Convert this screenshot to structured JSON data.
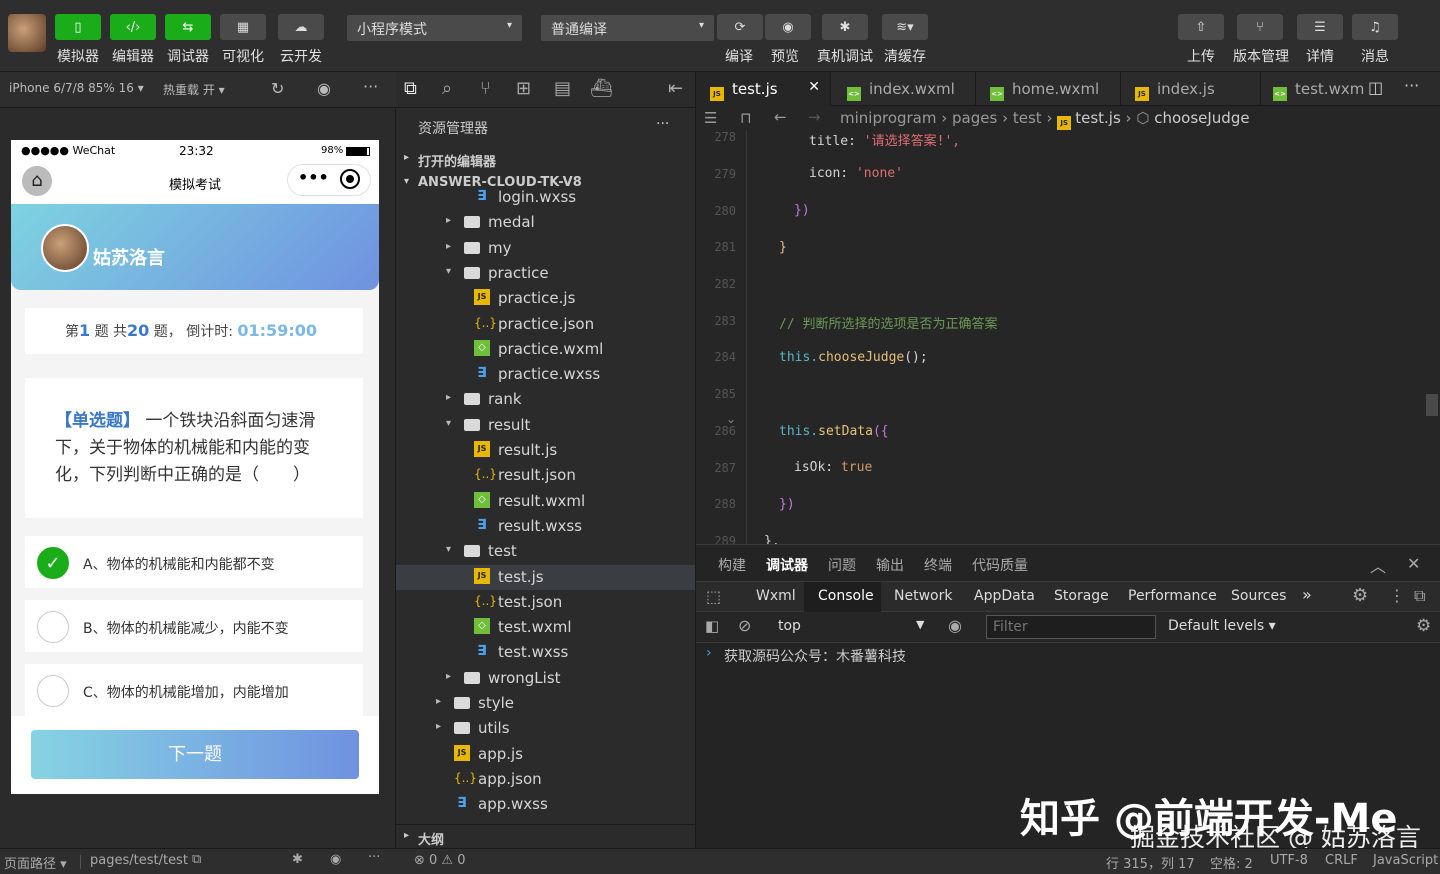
{
  "toolbar": {
    "buttons": [
      {
        "label": "模拟器",
        "icon": "phone-icon"
      },
      {
        "label": "编辑器",
        "icon": "code-icon"
      },
      {
        "label": "调试器",
        "icon": "debug-icon"
      },
      {
        "label": "可视化",
        "icon": "layout-icon"
      },
      {
        "label": "云开发",
        "icon": "cloud-icon"
      }
    ],
    "mode_select": "小程序模式",
    "compile_select": "普通编译",
    "actions": [
      {
        "label": "编译",
        "icon": "refresh-icon"
      },
      {
        "label": "预览",
        "icon": "eye-icon"
      },
      {
        "label": "真机调试",
        "icon": "bug-icon"
      },
      {
        "label": "清缓存",
        "icon": "layers-icon"
      }
    ],
    "right_actions": [
      {
        "label": "上传",
        "icon": "upload-icon"
      },
      {
        "label": "版本管理",
        "icon": "branch-icon"
      },
      {
        "label": "详情",
        "icon": "menu-icon"
      },
      {
        "label": "消息",
        "icon": "bell-icon"
      }
    ]
  },
  "simulator": {
    "device": "iPhone 6/7/8 85% 16 ▾",
    "hot_reload": "热重载 开 ▾",
    "status_left": "●●●●● WeChat",
    "status_time": "23:32",
    "status_battery": "98%",
    "nav_title": "模拟考试",
    "user_name": "姑苏洛言",
    "progress": {
      "prefix": "第",
      "current": "1",
      "mid": "题 共",
      "total": "20",
      "suffix": "题，",
      "timer_label": "倒计时:",
      "timer": "01:59:00"
    },
    "question_tag": "【单选题】",
    "question_text": "一个铁块沿斜面匀速滑下，关于物体的机械能和内能的变化，下列判断中正确的是（　　）",
    "options": [
      {
        "text": "A、物体的机械能和内能都不变",
        "checked": true
      },
      {
        "text": "B、物体的机械能减少，内能不变",
        "checked": false
      },
      {
        "text": "C、物体的机械能增加，内能增加",
        "checked": false
      }
    ],
    "next_button": "下一题"
  },
  "explorer": {
    "title": "资源管理器",
    "more": "···",
    "open_editors": "打开的编辑器",
    "project": "ANSWER-CLOUD-TK-V8",
    "outline": "大纲",
    "tree": [
      {
        "label": "login.wxss",
        "type": "wxss",
        "depth": 2,
        "arrow": ""
      },
      {
        "label": "medal",
        "type": "folder",
        "depth": 1,
        "arrow": "▸"
      },
      {
        "label": "my",
        "type": "folder",
        "depth": 1,
        "arrow": "▸"
      },
      {
        "label": "practice",
        "type": "folder",
        "depth": 1,
        "arrow": "▾"
      },
      {
        "label": "practice.js",
        "type": "js",
        "depth": 2,
        "arrow": ""
      },
      {
        "label": "practice.json",
        "type": "json",
        "depth": 2,
        "arrow": ""
      },
      {
        "label": "practice.wxml",
        "type": "wxml",
        "depth": 2,
        "arrow": ""
      },
      {
        "label": "practice.wxss",
        "type": "wxss",
        "depth": 2,
        "arrow": ""
      },
      {
        "label": "rank",
        "type": "folder",
        "depth": 1,
        "arrow": "▸"
      },
      {
        "label": "result",
        "type": "folder",
        "depth": 1,
        "arrow": "▾"
      },
      {
        "label": "result.js",
        "type": "js",
        "depth": 2,
        "arrow": ""
      },
      {
        "label": "result.json",
        "type": "json",
        "depth": 2,
        "arrow": ""
      },
      {
        "label": "result.wxml",
        "type": "wxml",
        "depth": 2,
        "arrow": ""
      },
      {
        "label": "result.wxss",
        "type": "wxss",
        "depth": 2,
        "arrow": ""
      },
      {
        "label": "test",
        "type": "folder",
        "depth": 1,
        "arrow": "▾"
      },
      {
        "label": "test.js",
        "type": "js",
        "depth": 2,
        "arrow": "",
        "selected": true
      },
      {
        "label": "test.json",
        "type": "json",
        "depth": 2,
        "arrow": ""
      },
      {
        "label": "test.wxml",
        "type": "wxml",
        "depth": 2,
        "arrow": ""
      },
      {
        "label": "test.wxss",
        "type": "wxss",
        "depth": 2,
        "arrow": ""
      },
      {
        "label": "wrongList",
        "type": "folder",
        "depth": 1,
        "arrow": "▸"
      },
      {
        "label": "style",
        "type": "folder",
        "depth": 0,
        "arrow": "▸"
      },
      {
        "label": "utils",
        "type": "folder",
        "depth": 0,
        "arrow": "▸"
      },
      {
        "label": "app.js",
        "type": "js",
        "depth": 0,
        "arrow": ""
      },
      {
        "label": "app.json",
        "type": "json",
        "depth": 0,
        "arrow": ""
      },
      {
        "label": "app.wxss",
        "type": "wxss",
        "depth": 0,
        "arrow": ""
      }
    ]
  },
  "editor": {
    "tabs": [
      {
        "label": "test.js",
        "type": "js",
        "active": true
      },
      {
        "label": "index.wxml",
        "type": "wxml"
      },
      {
        "label": "home.wxml",
        "type": "wxml"
      },
      {
        "label": "index.js",
        "type": "js"
      },
      {
        "label": "test.wxm",
        "type": "wxml"
      }
    ],
    "breadcrumb": [
      "miniprogram",
      "pages",
      "test",
      "test.js",
      "chooseJudge"
    ],
    "lines": [
      "278",
      "279",
      "280",
      "281",
      "282",
      "283",
      "284",
      "285",
      "286",
      "287",
      "288",
      "289"
    ],
    "code": {
      "title_key": "title: ",
      "title_val": "'请选择答案!',",
      "icon_key": "icon: ",
      "icon_val": "'none'",
      "close1": "})",
      "close2": "}",
      "comment": "// 判断所选择的选项是否为正确答案",
      "call_this": "this.",
      "call_fn": "chooseJudge",
      "call_end": "();",
      "set_this": "this.",
      "set_fn": "setData",
      "set_open": "({",
      "isok_key": "isOk: ",
      "isok_val": "true",
      "set_close": "})",
      "last": "},"
    }
  },
  "devtools": {
    "top_tabs": [
      "构建",
      "调试器",
      "问题",
      "输出",
      "终端",
      "代码质量"
    ],
    "active_top": "调试器",
    "panels": [
      "Wxml",
      "Console",
      "Network",
      "AppData",
      "Storage",
      "Performance",
      "Sources",
      "»"
    ],
    "active_panel": "Console",
    "context": "top",
    "filter_placeholder": "Filter",
    "levels": "Default levels ▾",
    "log": "获取源码公众号：木番薯科技"
  },
  "statusbar": {
    "page_path_label": "页面路径 ▾",
    "page_path": "pages/test/test",
    "errors": "⊗ 0 ⚠ 0",
    "position": "行 315，列 17",
    "indent": "空格: 2",
    "encoding": "UTF-8",
    "eol": "CRLF",
    "language": "JavaScript"
  },
  "watermark": {
    "line1": "知乎 @前端开发-Me",
    "line2": "掘金技术社区 @ 姑苏洛言"
  }
}
